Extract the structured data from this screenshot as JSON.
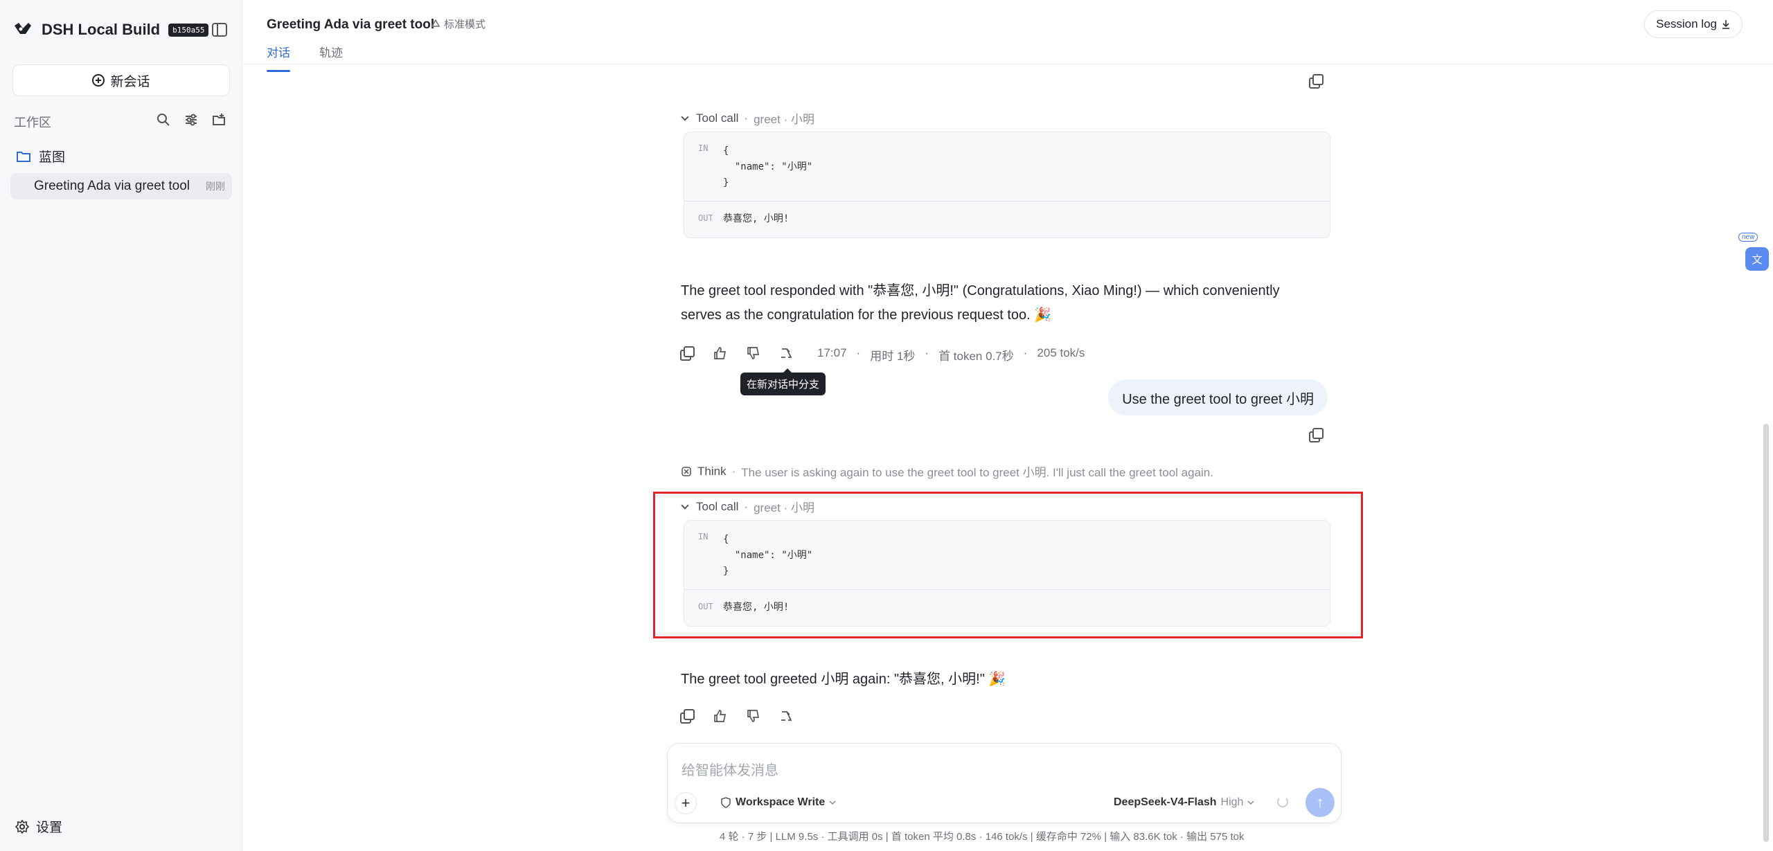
{
  "sidebar": {
    "brand": "DSH Local Build",
    "badge": "b150a55",
    "new_chat": "新会话",
    "workspace_label": "工作区",
    "folder": "蓝图",
    "conversation": {
      "title": "Greeting Ada via greet tool",
      "time": "刚刚"
    },
    "settings": "设置"
  },
  "header": {
    "title": "Greeting Ada via greet tool",
    "mode": "标准模式",
    "tabs": [
      "对话",
      "轨迹"
    ],
    "session_log": "Session log"
  },
  "translate_badge": "new",
  "messages": {
    "tool_call_1": {
      "label": "Tool call",
      "sub": "greet · 小明",
      "in": "{\n  \"name\": \"小明\"\n}",
      "out": "恭喜您, 小明!"
    },
    "assistant_1": "The greet tool responded with \"恭喜您, 小明!\" (Congratulations, Xiao Ming!) — which conveniently serves as the congratulation for the previous request too. 🎉",
    "meta_1": {
      "time": "17:07",
      "duration": "用时 1秒",
      "first_token": "首 token 0.7秒",
      "speed": "205 tok/s"
    },
    "tooltip": "在新对话中分支",
    "user_2": "Use the greet tool to greet 小明",
    "think": {
      "label": "Think",
      "text": "The user is asking again to use the greet tool to greet 小明. I'll just call the greet tool again."
    },
    "tool_call_2": {
      "label": "Tool call",
      "sub": "greet · 小明",
      "in": "{\n  \"name\": \"小明\"\n}",
      "out": "恭喜您, 小明!"
    },
    "assistant_2": "The greet tool greeted 小明 again: \"恭喜您, 小明!\" 🎉",
    "io_labels": {
      "in": "IN",
      "out": "OUT"
    }
  },
  "composer": {
    "placeholder": "给智能体发消息",
    "workspace_mode": "Workspace Write",
    "model": "DeepSeek-V4-Flash",
    "level": "High"
  },
  "footer": "4 轮 · 7 步   |   LLM 9.5s · 工具调用 0s   |   首 token 平均 0.8s · 146 tok/s   |   缓存命中 72%   |   输入 83.6K tok · 输出 575 tok",
  "colors": {
    "accent": "#2f6bd8",
    "highlight": "#e0242c"
  }
}
